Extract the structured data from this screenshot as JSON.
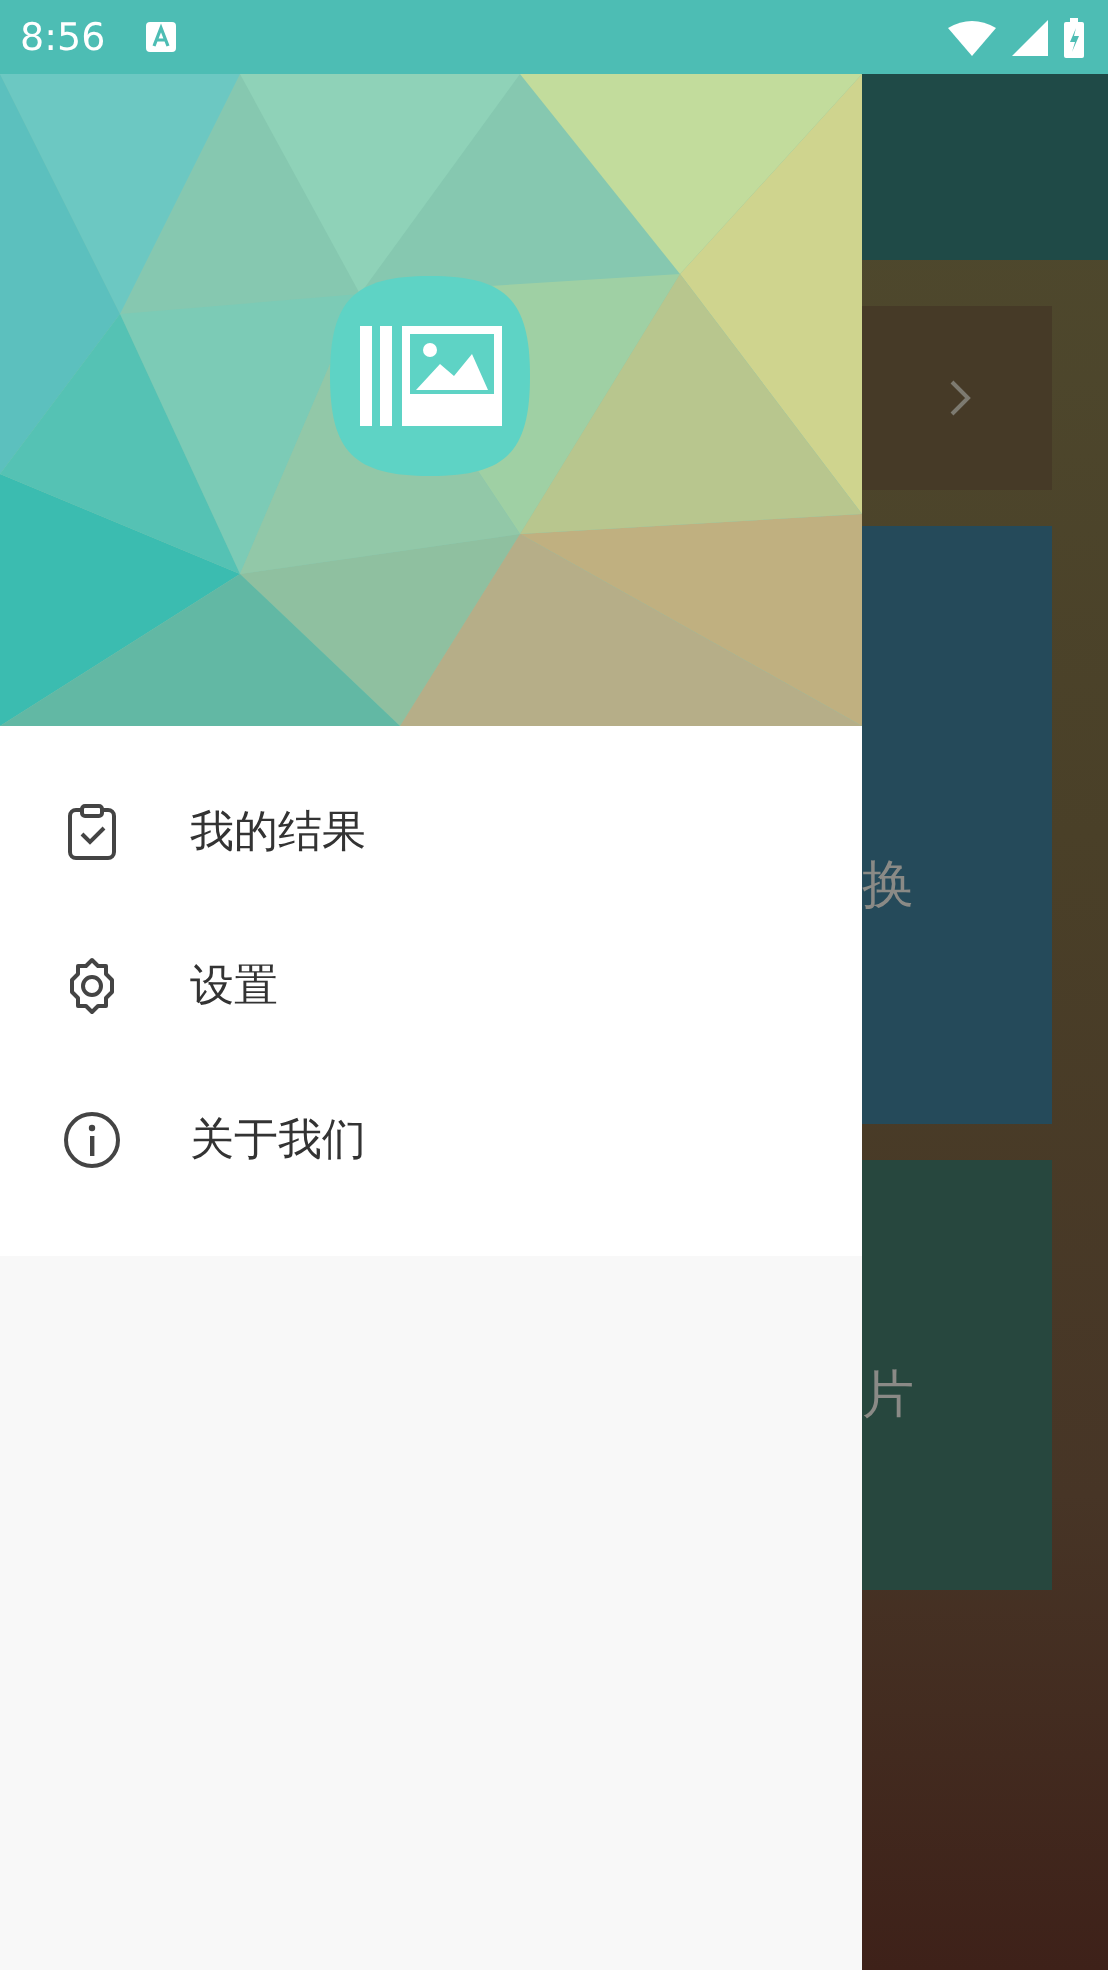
{
  "status_bar": {
    "time": "8:56"
  },
  "drawer": {
    "menu": [
      {
        "kind": "results",
        "label": "我的结果"
      },
      {
        "kind": "settings",
        "label": "设置"
      },
      {
        "kind": "about",
        "label": "关于我们"
      }
    ]
  },
  "background_screen": {
    "cards": [
      {
        "kind": "row"
      },
      {
        "kind": "feature",
        "label": "换"
      },
      {
        "kind": "feature",
        "label": "片"
      }
    ]
  }
}
